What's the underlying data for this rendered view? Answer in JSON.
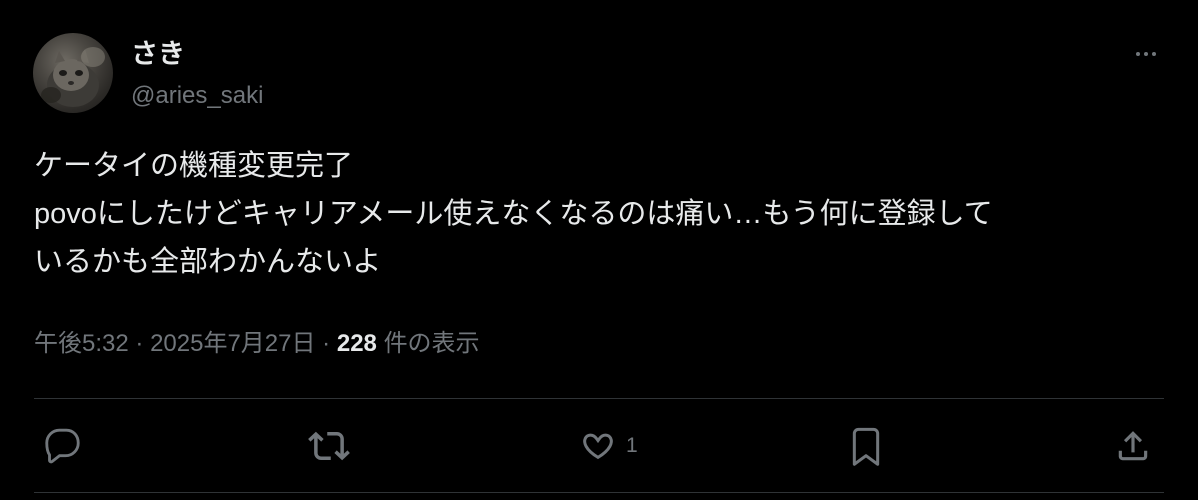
{
  "author": {
    "display_name": "さき",
    "handle": "@aries_saki"
  },
  "tweet": {
    "lines": [
      "ケータイの機種変更完了",
      "povoにしたけどキャリアメール使えなくなるのは痛い…もう何に登録して",
      "いるかも全部わかんないよ"
    ]
  },
  "meta": {
    "time": "午後5:32",
    "separator": "·",
    "date": "2025年7月27日",
    "views_count": "228",
    "views_label": "件の表示"
  },
  "actions": {
    "reply": {
      "icon": "reply-icon"
    },
    "retweet": {
      "icon": "retweet-icon"
    },
    "like": {
      "icon": "heart-icon",
      "count": "1"
    },
    "bookmark": {
      "icon": "bookmark-icon"
    },
    "share": {
      "icon": "share-icon"
    }
  },
  "theme": {
    "background": "#000000",
    "text": "#e7e9ea",
    "muted": "#71767b",
    "divider": "#2f3336"
  }
}
